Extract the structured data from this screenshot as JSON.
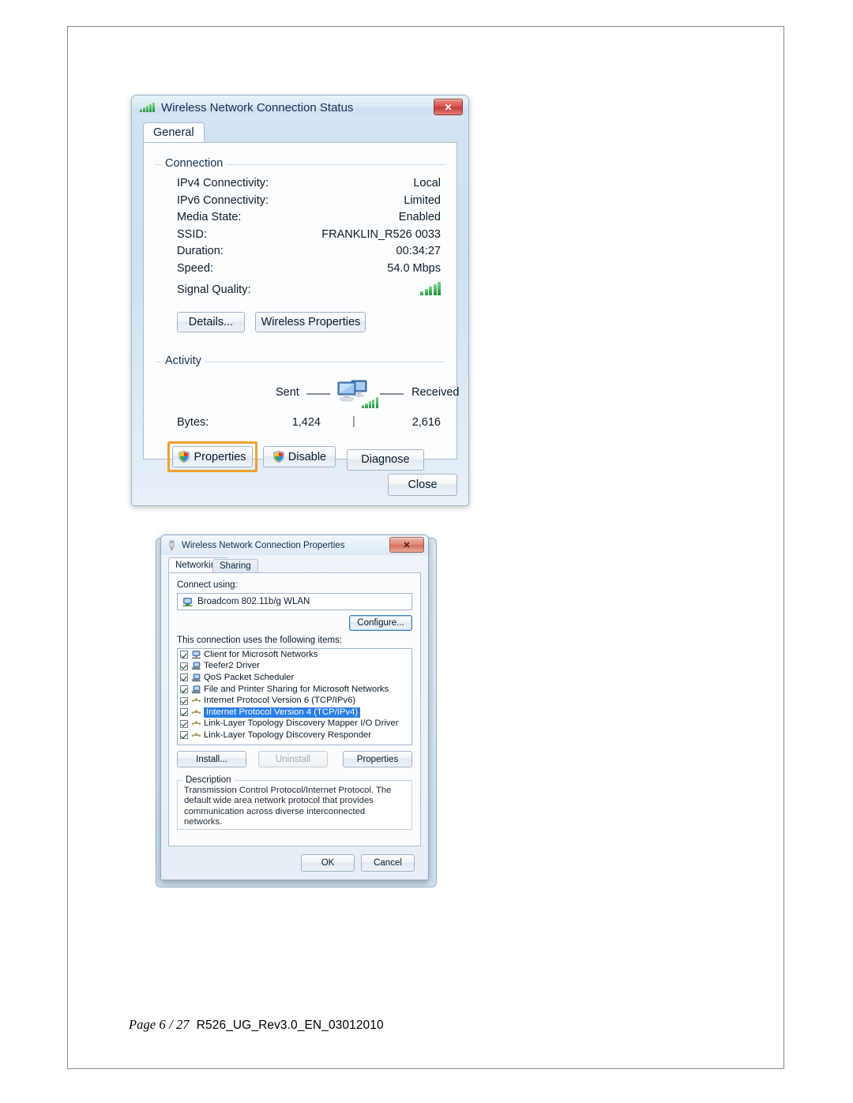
{
  "document": {
    "footer": {
      "page_label": "Page 6 / 27",
      "doc_id": "R526_UG_Rev3.0_EN_03012010"
    }
  },
  "status_dialog": {
    "title": "Wireless Network Connection Status",
    "title_icon": "wifi-signal-icon",
    "close_label": "✕",
    "tabs": [
      {
        "label": "General",
        "active": true
      }
    ],
    "connection_group": {
      "label": "Connection",
      "rows": [
        {
          "key": "IPv4 Connectivity:",
          "value": "Local"
        },
        {
          "key": "IPv6 Connectivity:",
          "value": "Limited"
        },
        {
          "key": "Media State:",
          "value": "Enabled"
        },
        {
          "key": "SSID:",
          "value": "FRANKLIN_R526 0033"
        },
        {
          "key": "Duration:",
          "value": "00:34:27"
        },
        {
          "key": "Speed:",
          "value": "54.0 Mbps"
        }
      ],
      "signal_quality_label": "Signal Quality:",
      "signal_bars": 5,
      "buttons": [
        {
          "label": "Details...",
          "name": "details-button"
        },
        {
          "label": "Wireless Properties",
          "name": "wireless-properties-button"
        }
      ]
    },
    "activity_group": {
      "label": "Activity",
      "sent_label": "Sent",
      "received_label": "Received",
      "bytes_label": "Bytes:",
      "bytes_sent": "1,424",
      "bytes_received": "2,616"
    },
    "action_buttons": [
      {
        "label": "Properties",
        "name": "properties-button",
        "shield": true,
        "highlighted": true
      },
      {
        "label": "Disable",
        "name": "disable-button",
        "shield": true,
        "highlighted": false
      },
      {
        "label": "Diagnose",
        "name": "diagnose-button",
        "shield": false,
        "highlighted": false
      }
    ],
    "close_button_label": "Close"
  },
  "properties_dialog": {
    "title": "Wireless Network Connection Properties",
    "title_icon": "network-adapter-icon",
    "close_label": "✕",
    "tabs": [
      {
        "label": "Networking",
        "active": true
      },
      {
        "label": "Sharing",
        "active": false
      }
    ],
    "connect_using_label": "Connect using:",
    "adapter_name": "Broadcom 802.11b/g WLAN",
    "configure_label": "Configure...",
    "items_label": "This connection uses the following items:",
    "items": [
      {
        "label": "Client for Microsoft Networks",
        "checked": true,
        "selected": false,
        "icon": "client-network-icon"
      },
      {
        "label": "Teefer2 Driver",
        "checked": true,
        "selected": false,
        "icon": "service-icon"
      },
      {
        "label": "QoS Packet Scheduler",
        "checked": true,
        "selected": false,
        "icon": "service-icon"
      },
      {
        "label": "File and Printer Sharing for Microsoft Networks",
        "checked": true,
        "selected": false,
        "icon": "service-icon"
      },
      {
        "label": "Internet Protocol Version 6 (TCP/IPv6)",
        "checked": true,
        "selected": false,
        "icon": "protocol-icon"
      },
      {
        "label": "Internet Protocol Version 4 (TCP/IPv4)",
        "checked": true,
        "selected": true,
        "icon": "protocol-icon"
      },
      {
        "label": "Link-Layer Topology Discovery Mapper I/O Driver",
        "checked": true,
        "selected": false,
        "icon": "protocol-icon"
      },
      {
        "label": "Link-Layer Topology Discovery Responder",
        "checked": true,
        "selected": false,
        "icon": "protocol-icon"
      }
    ],
    "item_buttons": [
      {
        "label": "Install...",
        "name": "install-button",
        "disabled": false
      },
      {
        "label": "Uninstall",
        "name": "uninstall-button",
        "disabled": true
      },
      {
        "label": "Properties",
        "name": "item-properties-button",
        "disabled": false
      }
    ],
    "description": {
      "label": "Description",
      "text": "Transmission Control Protocol/Internet Protocol. The default wide area network protocol that provides communication across diverse interconnected networks."
    },
    "ok_label": "OK",
    "cancel_label": "Cancel"
  },
  "colors": {
    "highlight_orange": "#f0a030",
    "selection_blue": "#2a7fe8",
    "signal_green": "#1f8c3b"
  }
}
